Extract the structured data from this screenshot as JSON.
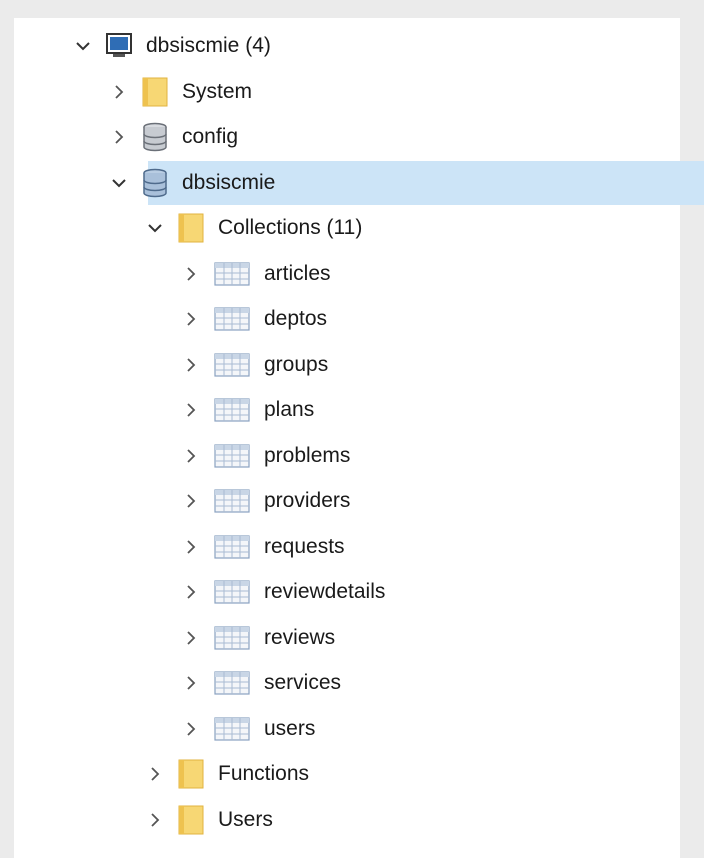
{
  "tree": {
    "connection": {
      "label": "dbsiscmie (4)",
      "expanded": true,
      "icon": "monitor-icon"
    },
    "databases": [
      {
        "label": "System",
        "icon": "folder-icon",
        "expanded": false
      },
      {
        "label": "config",
        "icon": "database-icon",
        "expanded": false
      },
      {
        "label": "dbsiscmie",
        "icon": "database-icon",
        "expanded": true,
        "selected": true
      }
    ],
    "collections_folder": {
      "label": "Collections (11)",
      "icon": "folder-icon",
      "expanded": true
    },
    "collections": [
      {
        "label": "articles"
      },
      {
        "label": "deptos"
      },
      {
        "label": "groups"
      },
      {
        "label": "plans"
      },
      {
        "label": "problems"
      },
      {
        "label": "providers"
      },
      {
        "label": "requests"
      },
      {
        "label": "reviewdetails"
      },
      {
        "label": "reviews"
      },
      {
        "label": "services"
      },
      {
        "label": "users"
      }
    ],
    "folders": [
      {
        "label": "Functions",
        "icon": "folder-icon",
        "expanded": false
      },
      {
        "label": "Users",
        "icon": "folder-icon",
        "expanded": false
      }
    ]
  },
  "colors": {
    "selection": "#cce4f7",
    "folder": "#f7d774",
    "database": "#8a8f96",
    "monitor": "#2f6db5"
  }
}
